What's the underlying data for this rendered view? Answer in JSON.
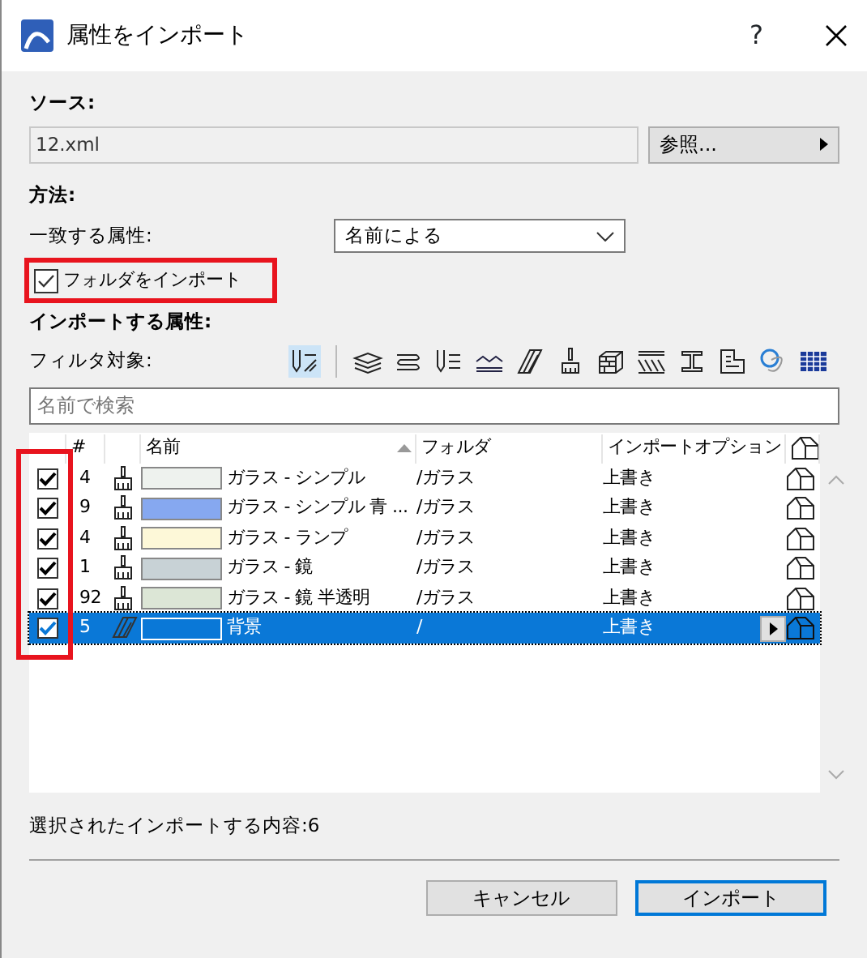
{
  "window": {
    "title": "属性をインポート",
    "help": "?"
  },
  "source": {
    "label": "ソース:",
    "value": "12.xml",
    "browse": "参照..."
  },
  "method": {
    "label": "方法:",
    "match_label": "一致する属性:",
    "match_value": "名前による",
    "import_folders": {
      "label": "フォルダをインポート",
      "checked": true,
      "highlighted": true
    }
  },
  "attributes": {
    "label": "インポートする属性:",
    "filter_label": "フィルタ対象:",
    "filters": [
      {
        "selected": true
      },
      {
        "selected": false
      },
      {
        "selected": false
      },
      {
        "selected": false
      },
      {
        "selected": false
      },
      {
        "selected": false
      },
      {
        "selected": false
      },
      {
        "selected": false
      },
      {
        "selected": false
      },
      {
        "selected": false
      },
      {
        "selected": false
      },
      {
        "selected": false
      },
      {
        "selected": false
      }
    ],
    "search": {
      "placeholder": "名前で検索"
    },
    "columns": [
      "#",
      "名前",
      "フォルダ",
      "インポートオプション"
    ],
    "checkbox_column_highlighted": true,
    "rows": [
      {
        "checked": true,
        "number": "4",
        "kind": "brush",
        "color": "#eef2ee",
        "name": "ガラス - シンプル",
        "folder": "/ガラス",
        "option": "上書き",
        "selected": false
      },
      {
        "checked": true,
        "number": "9",
        "kind": "brush",
        "color": "#86a8f0",
        "name": "ガラス - シンプル 青 ...",
        "folder": "/ガラス",
        "option": "上書き",
        "selected": false
      },
      {
        "checked": true,
        "number": "4",
        "kind": "brush",
        "color": "#fdf8d8",
        "name": "ガラス - ランプ",
        "folder": "/ガラス",
        "option": "上書き",
        "selected": false
      },
      {
        "checked": true,
        "number": "1",
        "kind": "brush",
        "color": "#c8d2d6",
        "name": "ガラス - 鏡",
        "folder": "/ガラス",
        "option": "上書き",
        "selected": false
      },
      {
        "checked": true,
        "number": "92",
        "kind": "brush",
        "color": "#dce6d6",
        "name": "ガラス - 鏡 半透明",
        "folder": "/ガラス",
        "option": "上書き",
        "selected": false
      },
      {
        "checked": true,
        "number": "5",
        "kind": "hatch",
        "color": "#0a78d7",
        "name": "背景",
        "folder": "/",
        "option": "上書き",
        "selected": true
      }
    ]
  },
  "status": "選択されたインポートする内容:6",
  "buttons": [
    "キャンセル",
    "インポート"
  ]
}
